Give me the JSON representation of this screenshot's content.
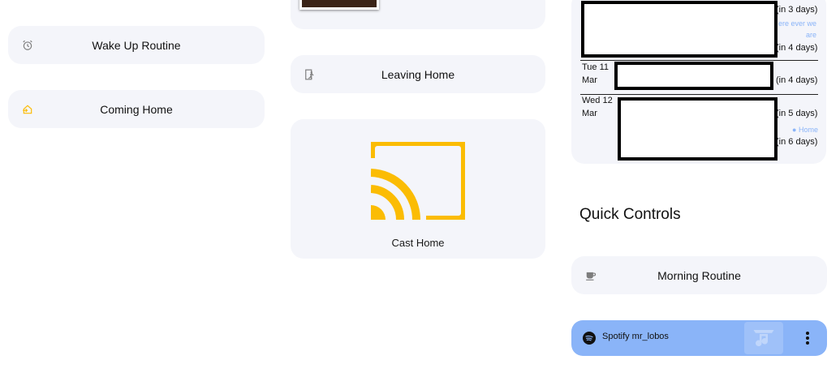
{
  "column_left": {
    "wake_up": {
      "label": "Wake Up Routine",
      "icon": "alarm-clock-icon"
    },
    "coming_home": {
      "label": "Coming Home",
      "icon": "home-import-icon"
    }
  },
  "column_middle": {
    "leaving_home": {
      "label": "Leaving Home",
      "icon": "exit-run-icon"
    },
    "cast_home": {
      "label": "Cast Home",
      "icon": "cast-icon",
      "icon_color": "#fbbc04"
    }
  },
  "calendar": {
    "events": [
      {
        "relative": "(in 3 days)",
        "location": "ere ever we are"
      },
      {
        "relative": "(in 4 days)"
      },
      {
        "date": "Tue 11",
        "month": "Mar",
        "relative": "(in 4 days)"
      },
      {
        "date": "Wed 12",
        "month": "Mar",
        "relative": "(in 5 days)",
        "location": "Home"
      },
      {
        "relative": "(in 6 days)"
      }
    ]
  },
  "quick_controls": {
    "title": "Quick Controls",
    "morning_routine": {
      "label": "Morning Routine",
      "icon": "coffee-icon"
    },
    "media": {
      "title": "Spotify mr_lobos",
      "icon": "spotify-icon",
      "art_icon": "music-note-icon",
      "menu_icon": "more-vertical-icon",
      "color": "#8ab4f8"
    }
  },
  "colors": {
    "card_bg": "#f4f5fa",
    "accent": "#fbbc04"
  }
}
